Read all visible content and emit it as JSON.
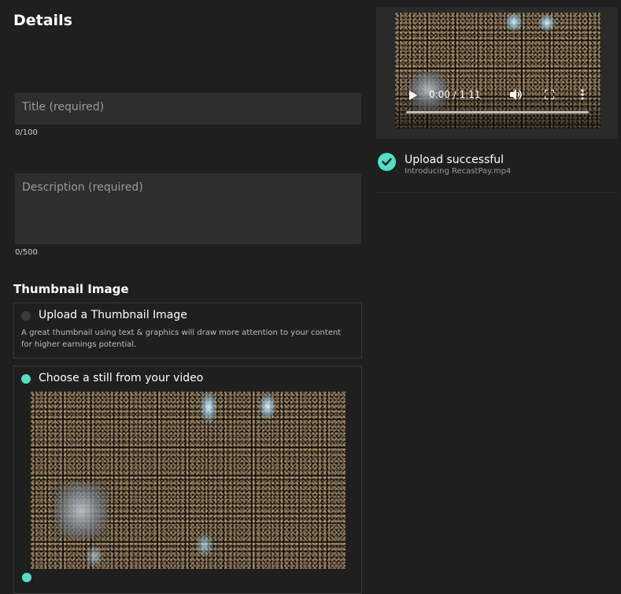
{
  "details": {
    "heading": "Details",
    "title_field": {
      "placeholder": "Title (required)",
      "value": "",
      "counter": "0/100"
    },
    "description_field": {
      "placeholder": "Description (required)",
      "value": "",
      "counter": "0/500"
    }
  },
  "thumbnail": {
    "heading": "Thumbnail Image",
    "options": [
      {
        "label": "Upload a Thumbnail Image",
        "description": "A great thumbnail using text & graphics will draw more attention to your content for higher earnings potential.",
        "selected": false
      },
      {
        "label": "Choose a still from your video",
        "selected": true
      }
    ]
  },
  "video_player": {
    "time_display": "0:00 / 1:11",
    "progress": 0,
    "icons": [
      "play-icon",
      "volume-icon",
      "fullscreen-icon",
      "more-options-icon"
    ]
  },
  "upload_status": {
    "title": "Upload successful",
    "filename": "Introducing RecastPay.mp4",
    "icon": "check-circle-icon"
  },
  "colors": {
    "accent": "#52e0c4",
    "background": "#1f1f1f",
    "field": "#2e2e2e"
  }
}
